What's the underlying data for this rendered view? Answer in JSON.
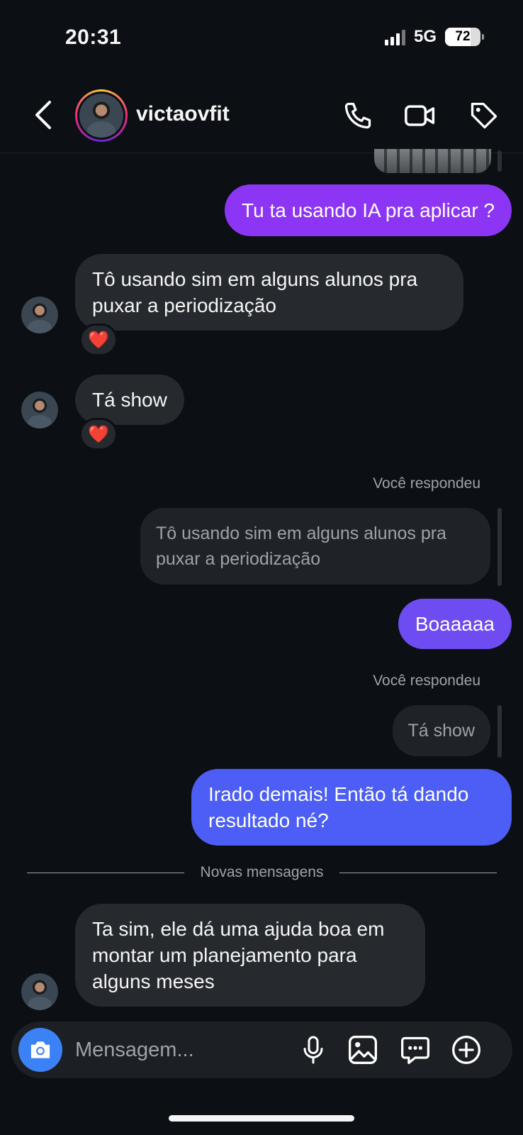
{
  "status_bar": {
    "time": "20:31",
    "network": "5G",
    "battery": "72"
  },
  "header": {
    "username": "victaovfit"
  },
  "messages": [
    {
      "text": "Tu ta usando IA pra aplicar ?"
    },
    {
      "text": "Tô usando sim em alguns alunos pra puxar a periodização",
      "reaction": "❤️"
    },
    {
      "text": "Tá show",
      "reaction": "❤️"
    },
    {
      "replied_label": "Você respondeu",
      "quote": "Tô usando sim em alguns alunos pra puxar a periodização",
      "text": "Boaaaaa"
    },
    {
      "replied_label": "Você respondeu",
      "quote": "Tá show",
      "text": "Irado demais! Então tá dando resultado né?"
    },
    {
      "text": "Ta sim, ele dá uma ajuda boa em montar um planejamento para alguns meses"
    }
  ],
  "divider_label": "Novas mensagens",
  "composer": {
    "placeholder": "Mensagem..."
  },
  "colors": {
    "bg": "#0c1014",
    "incoming": "#262a2f",
    "outgoing_purple": "#8c35f5",
    "outgoing_violet": "#6e4cf2",
    "outgoing_blue": "#4c5ef5",
    "camera": "#3b82f6"
  },
  "icons": [
    "back-icon",
    "phone-icon",
    "video-icon",
    "tag-icon",
    "camera-icon",
    "mic-icon",
    "image-icon",
    "sticker-icon",
    "add-icon"
  ]
}
